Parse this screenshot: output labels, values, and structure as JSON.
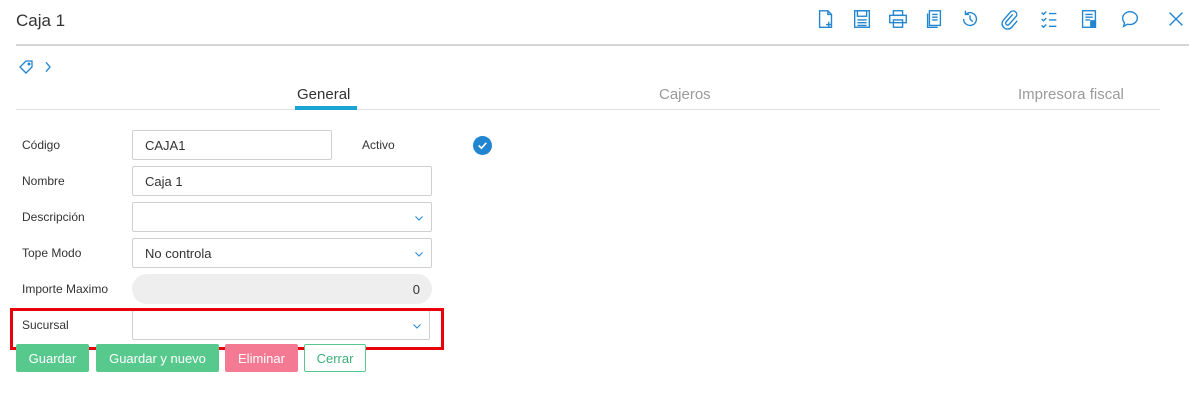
{
  "window": {
    "title": "Caja 1"
  },
  "toolbar": {
    "icons": [
      "new-document-icon",
      "save-icon",
      "print-icon",
      "copy-icon",
      "history-icon",
      "attachment-icon",
      "checklist-icon",
      "notes-icon",
      "comment-icon",
      "close-icon"
    ],
    "accent": "#2185d0"
  },
  "tabs": [
    {
      "label": "General",
      "active": true
    },
    {
      "label": "Cajeros",
      "active": false
    },
    {
      "label": "Impresora fiscal",
      "active": false
    }
  ],
  "form": {
    "codigo": {
      "label": "Código",
      "value": "CAJA1"
    },
    "activo": {
      "label": "Activo",
      "checked": true
    },
    "nombre": {
      "label": "Nombre",
      "value": "Caja 1"
    },
    "descripcion": {
      "label": "Descripción",
      "value": ""
    },
    "tope_modo": {
      "label": "Tope Modo",
      "value": "No controla"
    },
    "importe_maximo": {
      "label": "Importe Maximo",
      "value": "0"
    },
    "sucursal": {
      "label": "Sucursal",
      "value": ""
    }
  },
  "buttons": {
    "guardar": "Guardar",
    "guardar_nuevo": "Guardar y nuevo",
    "eliminar": "Eliminar",
    "cerrar": "Cerrar"
  },
  "colors": {
    "highlight": "#e8000b",
    "tab_underline": "#1ba3d4",
    "save_green": "#57c98d",
    "delete_pink": "#f47a94"
  }
}
